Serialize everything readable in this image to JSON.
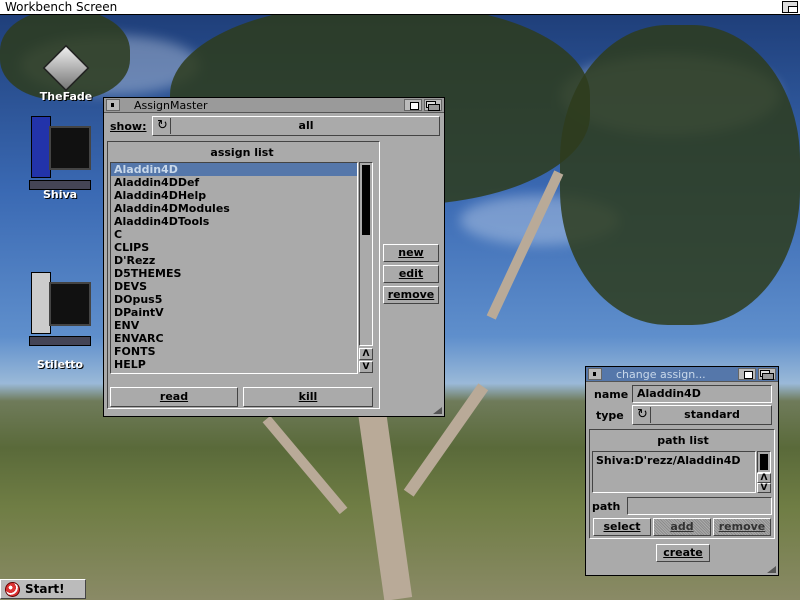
{
  "screen": {
    "title": "Workbench Screen"
  },
  "desktop_icons": [
    {
      "label": "TheFade"
    },
    {
      "label": "Shiva"
    },
    {
      "label": "Stiletto"
    }
  ],
  "start_button": {
    "label": "Start!"
  },
  "assign_master": {
    "title": "AssignMaster",
    "show_label": "show:",
    "show_value": "all",
    "list_title": "assign list",
    "assigns": [
      "Aladdin4D",
      "Aladdin4DDef",
      "Aladdin4DHelp",
      "Aladdin4DModules",
      "Aladdin4DTools",
      "C",
      "CLIPS",
      "D'Rezz",
      "D5THEMES",
      "DEVS",
      "DOpus5",
      "DPaintV",
      "ENV",
      "ENVARC",
      "FONTS",
      "HELP"
    ],
    "selected_index": 0,
    "scroll": {
      "up": "Λ",
      "down": "V"
    },
    "buttons": {
      "new": "new",
      "edit": "edit",
      "remove": "remove",
      "read": "read",
      "kill": "kill"
    }
  },
  "change_assign": {
    "title": "change assign...",
    "name_label": "name",
    "name_value": "Aladdin4D",
    "type_label": "type",
    "type_value": "standard",
    "path_list_title": "path list",
    "paths": [
      "Shiva:D'rezz/Aladdin4D"
    ],
    "path_label": "path",
    "path_value": "",
    "buttons": {
      "select": "select",
      "add": "add",
      "remove": "remove",
      "create": "create"
    },
    "scroll": {
      "up": "Λ",
      "down": "V"
    }
  }
}
